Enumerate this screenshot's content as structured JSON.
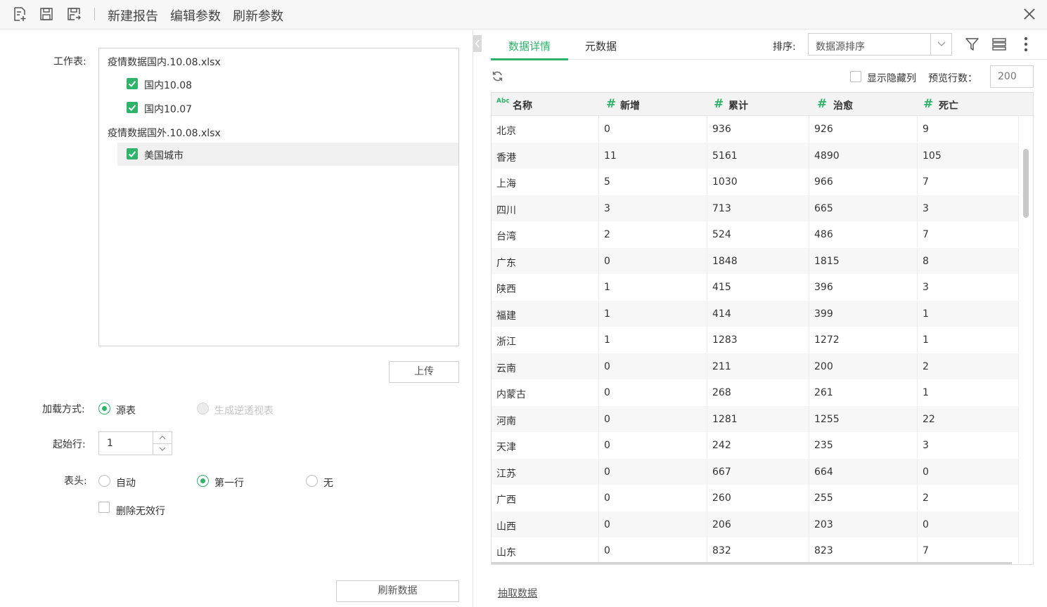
{
  "toolbar": {
    "new_report": "新建报告",
    "edit_params": "编辑参数",
    "refresh_params": "刷新参数"
  },
  "left": {
    "worksheet_label": "工作表:",
    "files": [
      {
        "name": "疫情数据国内.10.08.xlsx",
        "sheets": [
          {
            "name": "国内10.08",
            "checked": true
          },
          {
            "name": "国内10.07",
            "checked": true
          }
        ]
      },
      {
        "name": "疫情数据国外.10.08.xlsx",
        "sheets": [
          {
            "name": "美国城市",
            "checked": true
          }
        ]
      }
    ],
    "upload_button": "上传",
    "load_mode_label": "加载方式:",
    "load_mode_options": [
      "源表",
      "生成逆透视表"
    ],
    "start_row_label": "起始行:",
    "start_row_value": "1",
    "header_label": "表头:",
    "header_options": [
      "自动",
      "第一行",
      "无"
    ],
    "delete_invalid_rows": "删除无效行",
    "refresh_data_button": "刷新数据"
  },
  "right": {
    "tabs": [
      "数据详情",
      "元数据"
    ],
    "sort_label": "排序:",
    "sort_value": "数据源排序",
    "show_hidden_columns": "显示隐藏列",
    "preview_rows_label": "预览行数：",
    "preview_rows_value": "200",
    "extract_data_link": "抽取数据"
  },
  "icons": {
    "new": "new-report-icon",
    "save": "save-icon",
    "save_as": "save-as-icon",
    "close": "close-icon",
    "filter": "filter-icon",
    "columns": "column-list-icon",
    "more": "more-vertical-icon",
    "refresh": "refresh-icon",
    "collapse": "chevron-left-icon"
  },
  "colors": {
    "accent": "#2fb36a"
  },
  "table": {
    "columns": [
      {
        "type": "Abc",
        "name": "名称"
      },
      {
        "type": "#",
        "name": "新增"
      },
      {
        "type": "#",
        "name": "累计"
      },
      {
        "type": "#",
        "name": "治愈"
      },
      {
        "type": "#",
        "name": "死亡"
      }
    ],
    "rows": [
      [
        "北京",
        "0",
        "936",
        "926",
        "9"
      ],
      [
        "香港",
        "11",
        "5161",
        "4890",
        "105"
      ],
      [
        "上海",
        "5",
        "1030",
        "966",
        "7"
      ],
      [
        "四川",
        "3",
        "713",
        "665",
        "3"
      ],
      [
        "台湾",
        "2",
        "524",
        "486",
        "7"
      ],
      [
        "广东",
        "0",
        "1848",
        "1815",
        "8"
      ],
      [
        "陕西",
        "1",
        "415",
        "396",
        "3"
      ],
      [
        "福建",
        "1",
        "414",
        "399",
        "1"
      ],
      [
        "浙江",
        "1",
        "1283",
        "1272",
        "1"
      ],
      [
        "云南",
        "0",
        "211",
        "200",
        "2"
      ],
      [
        "内蒙古",
        "0",
        "268",
        "261",
        "1"
      ],
      [
        "河南",
        "0",
        "1281",
        "1255",
        "22"
      ],
      [
        "天津",
        "0",
        "242",
        "235",
        "3"
      ],
      [
        "江苏",
        "0",
        "667",
        "664",
        "0"
      ],
      [
        "广西",
        "0",
        "260",
        "255",
        "2"
      ],
      [
        "山西",
        "0",
        "206",
        "203",
        "0"
      ],
      [
        "山东",
        "0",
        "832",
        "823",
        "7"
      ]
    ]
  }
}
